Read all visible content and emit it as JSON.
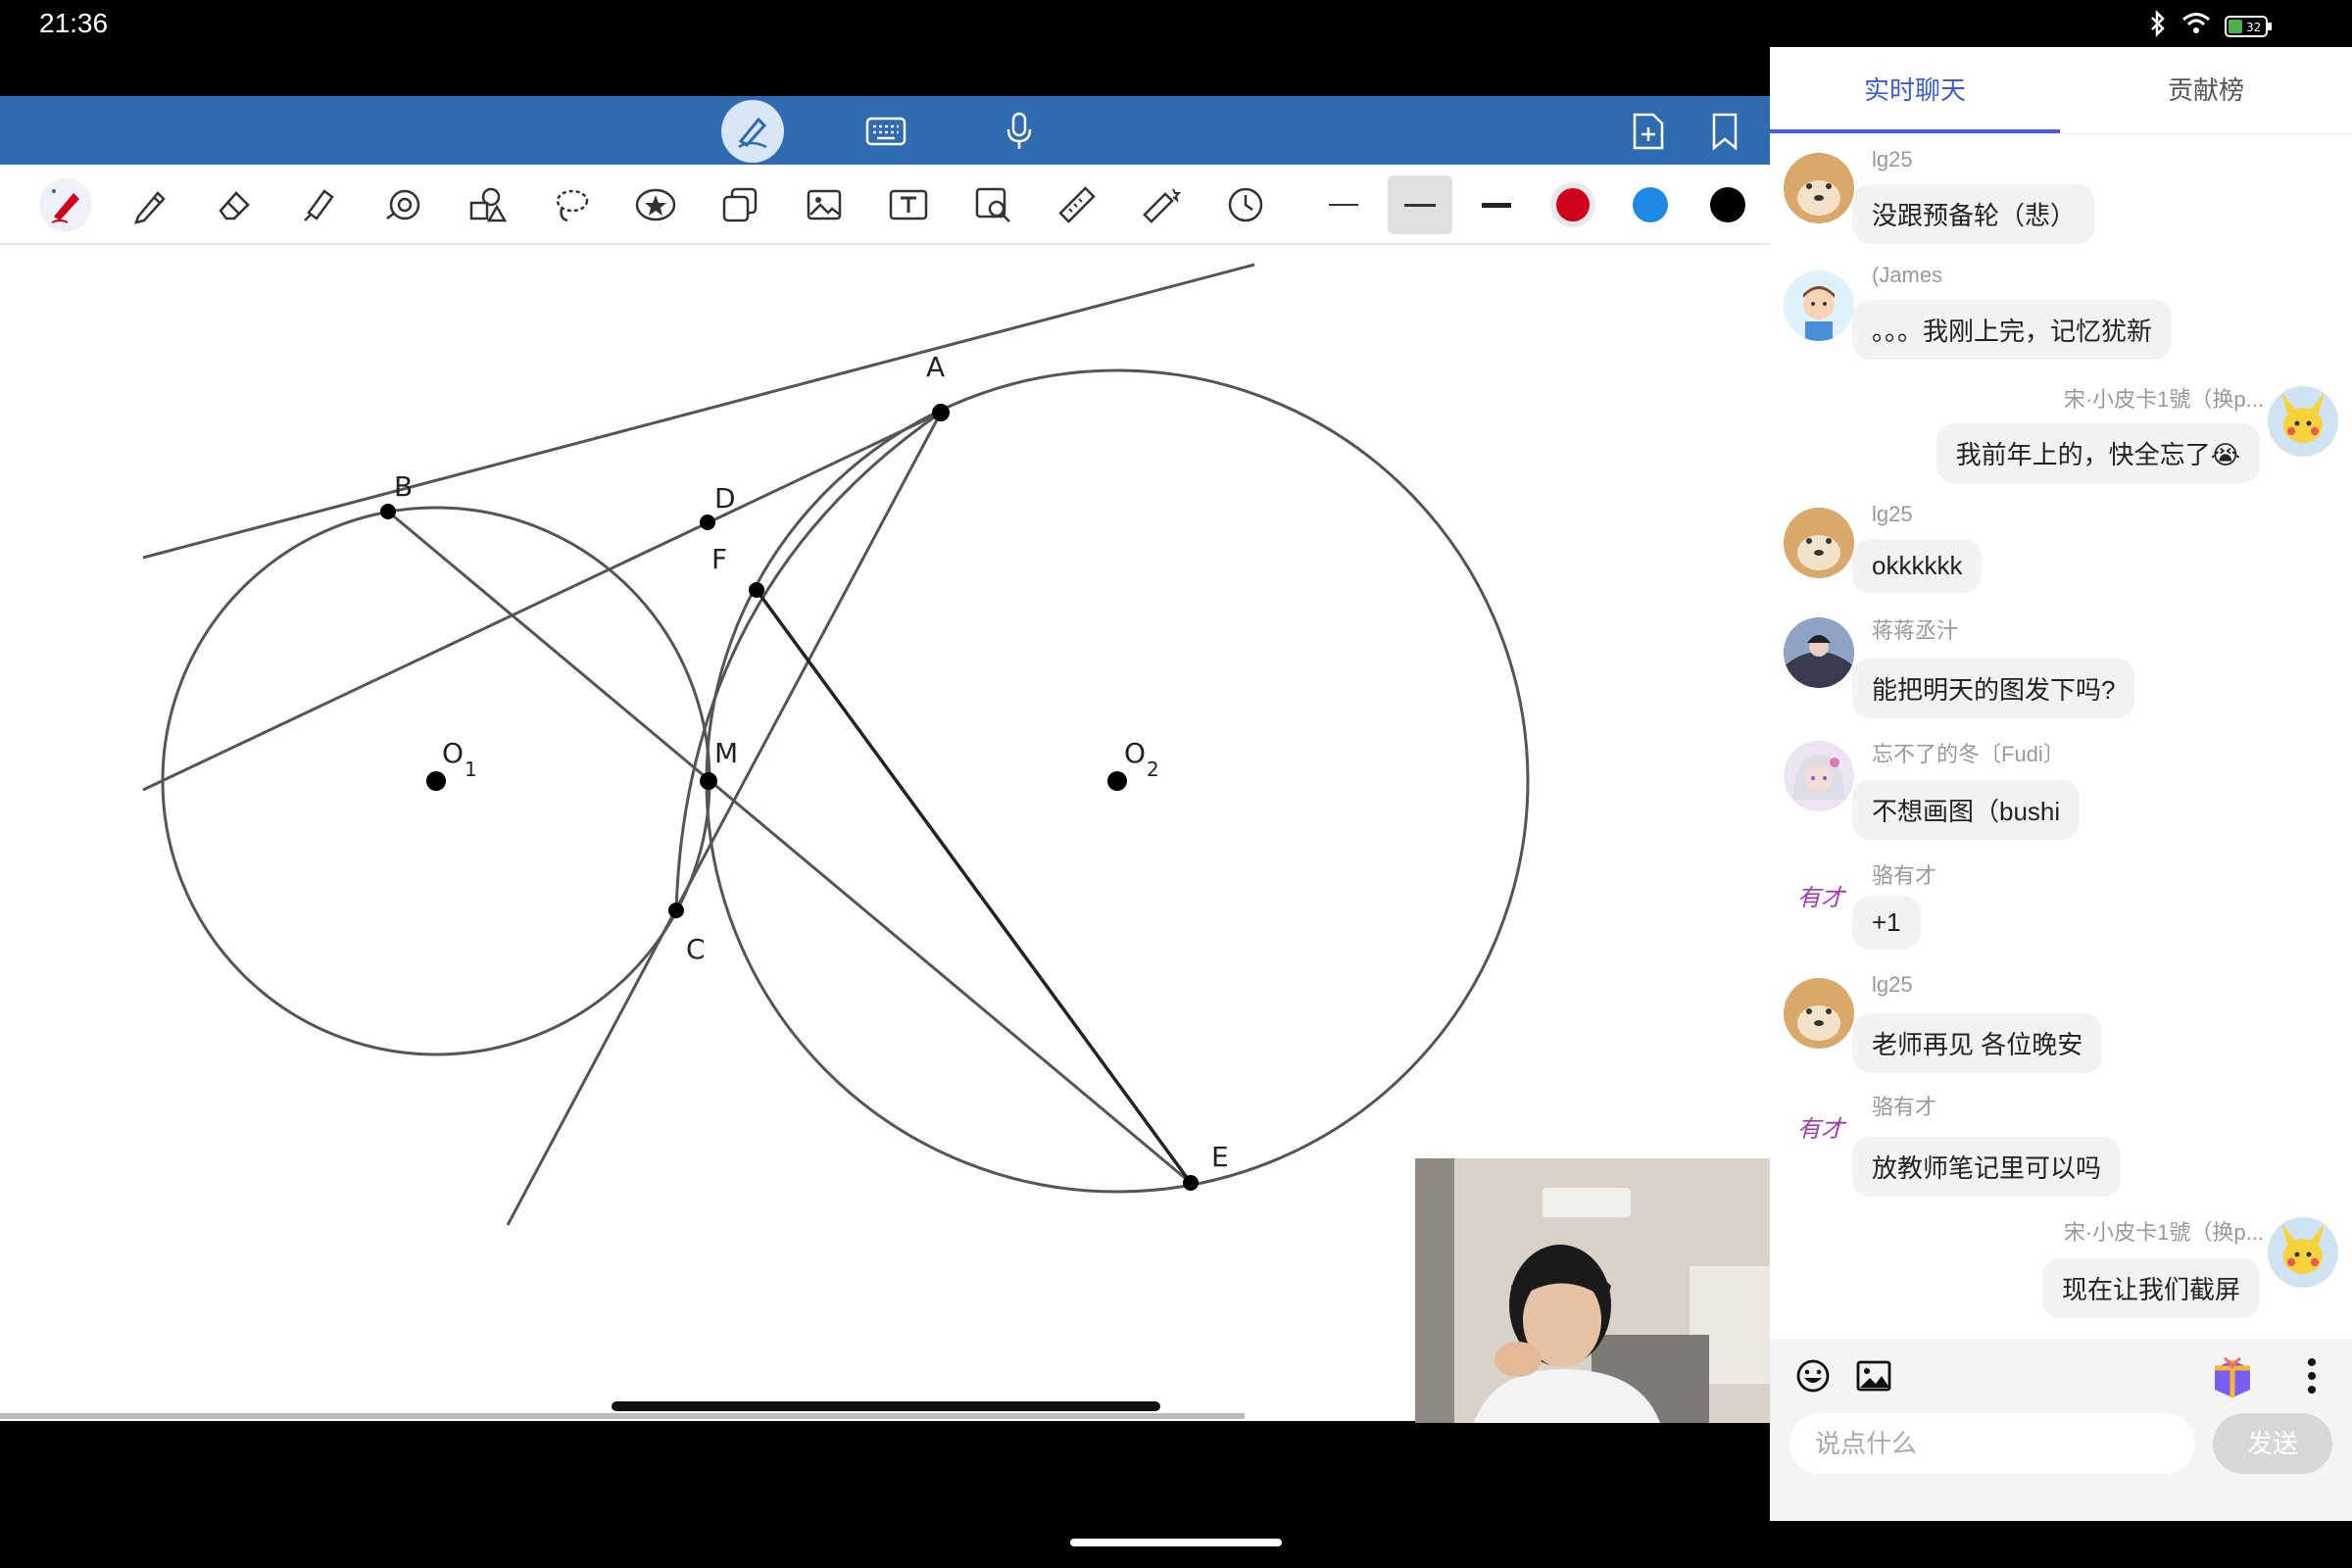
{
  "status": {
    "time": "21:36",
    "battery": "32"
  },
  "tabs": {
    "live_chat": "实时聊天",
    "contributions": "贡献榜"
  },
  "geometry_labels": {
    "A": "A",
    "B": "B",
    "C": "C",
    "D": "D",
    "E": "E",
    "F": "F",
    "M": "M",
    "O1": "O",
    "O1_sub": "1",
    "O2": "O",
    "O2_sub": "2"
  },
  "messages": [
    {
      "name": "lg25",
      "text": "没跟预备轮（悲）",
      "side": "left",
      "avatar": "doge"
    },
    {
      "name": "(James",
      "text": "。。。我刚上完，记忆犹新",
      "side": "left",
      "avatar": "cartoon-boy"
    },
    {
      "name": "宋·小皮卡1號（换p...",
      "text": "我前年上的，快全忘了😭",
      "side": "right",
      "avatar": "pikachu"
    },
    {
      "name": "lg25",
      "text": "okkkkkk",
      "side": "left",
      "avatar": "doge"
    },
    {
      "name": "蒋蒋丞汁",
      "text": "能把明天的图发下吗?",
      "side": "left",
      "avatar": "anime-character"
    },
    {
      "name": "忘不了的冬〔Fudi〕",
      "text": "不想画图（bushi",
      "side": "left",
      "avatar": "anime-girl"
    },
    {
      "name": "骆有才",
      "text": "+1",
      "side": "left",
      "avatar": "calligraphy"
    },
    {
      "name": "lg25",
      "text": "老师再见 各位晚安",
      "side": "left",
      "avatar": "doge"
    },
    {
      "name": "骆有才",
      "text": "放教师笔记里可以吗",
      "side": "left",
      "avatar": "calligraphy"
    },
    {
      "name": "宋·小皮卡1號（换p...",
      "text": "现在让我们截屏",
      "side": "right",
      "avatar": "pikachu"
    }
  ],
  "calligraphy_avatar_text": "有才",
  "input": {
    "placeholder": "说点什么",
    "send_label": "发送"
  },
  "colors": {
    "accent": "#3b5bdb",
    "toolbar": "#2f6bb0",
    "red_pen": "#d0021b",
    "blue_pen": "#1e88e5",
    "black_pen": "#000000"
  }
}
